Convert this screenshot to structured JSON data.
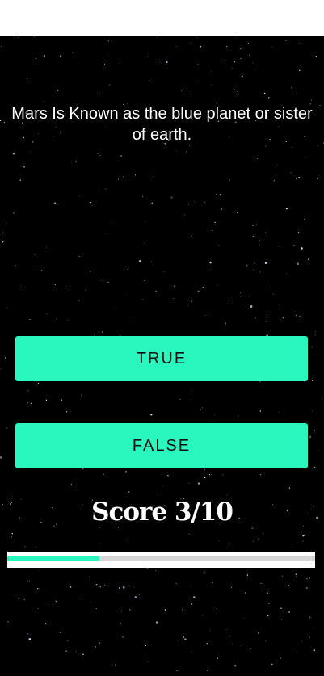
{
  "quiz": {
    "question": "Mars Is Known as the blue planet or sister of earth.",
    "true_label": "TRUE",
    "false_label": "FALSE",
    "score_text": "Score 3/10",
    "progress_fraction": 0.3
  },
  "colors": {
    "background": "#000000",
    "accent": "#29f7bd",
    "text": "#ffffff",
    "track": "#d6d6d6"
  },
  "icons": {
    "background": "starfield"
  }
}
